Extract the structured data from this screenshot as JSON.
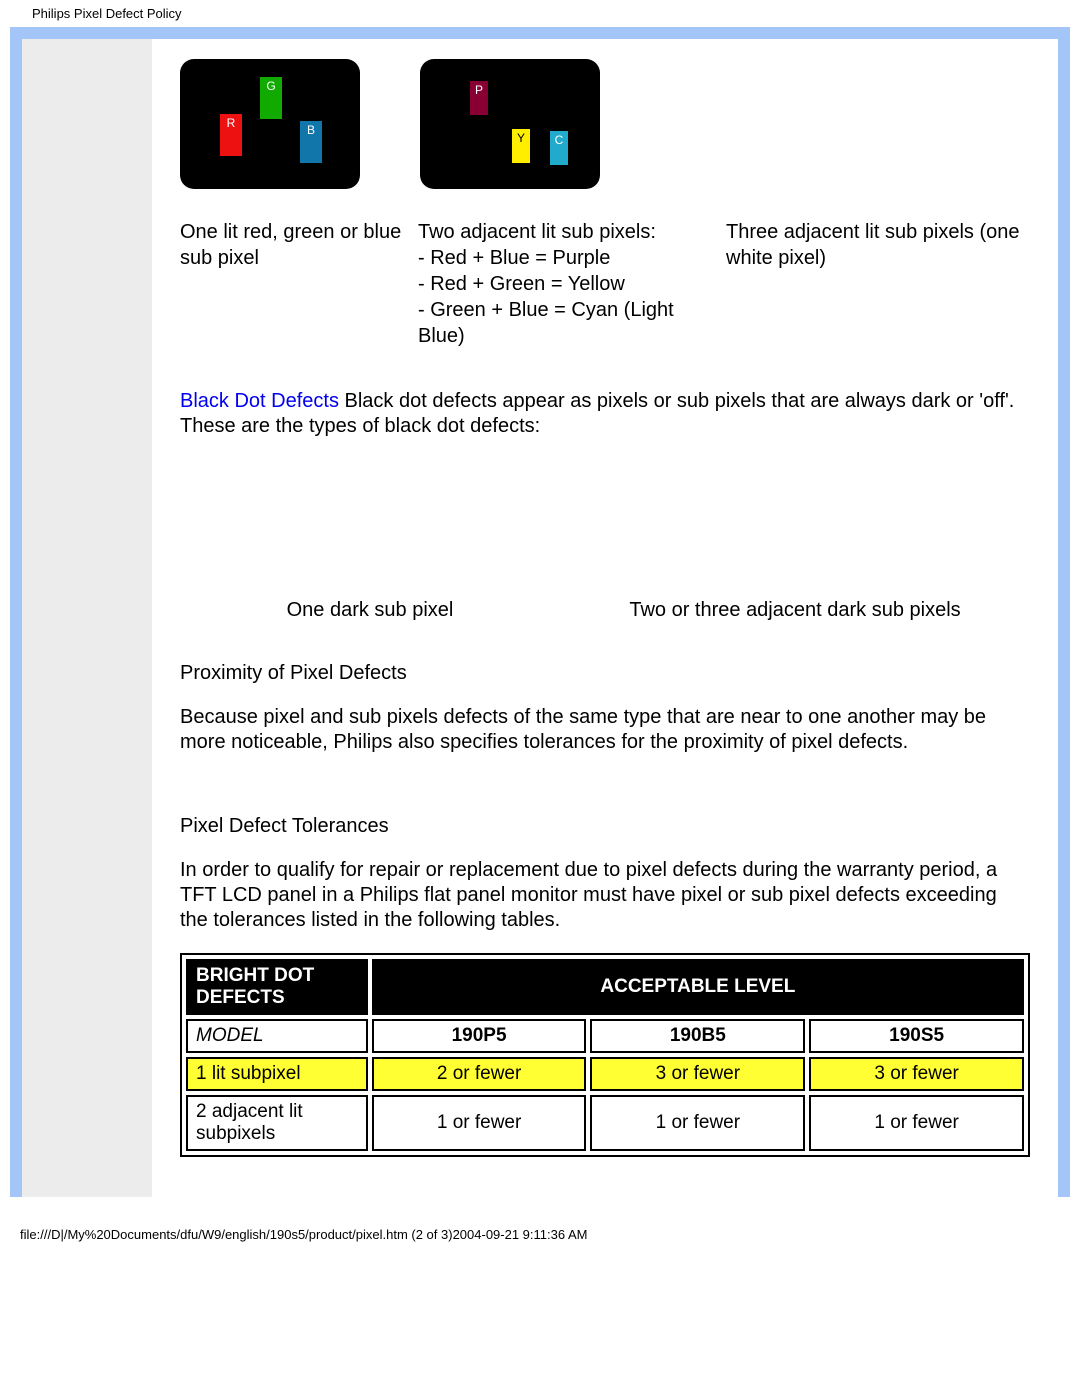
{
  "header": "Philips Pixel Defect Policy",
  "diagrams": {
    "d1": {
      "r": "R",
      "g": "G",
      "b": "B"
    },
    "d2": {
      "p": "P",
      "y": "Y",
      "c": "C"
    }
  },
  "captions": {
    "c1": "One lit red, green or blue sub pixel",
    "c2": "Two adjacent lit sub pixels:\n- Red + Blue = Purple\n- Red + Green = Yellow\n- Green + Blue = Cyan (Light Blue)",
    "c3": "Three adjacent lit sub pixels (one white pixel)"
  },
  "black_dot": {
    "link": "Black Dot Defects",
    "text": " Black dot defects appear as pixels or sub pixels that are always dark or 'off'. These are the types of black dot defects:"
  },
  "dark_captions": {
    "d1": "One dark sub pixel",
    "d2": "Two or three adjacent dark sub pixels"
  },
  "sections": {
    "proximity_title": "Proximity of Pixel Defects",
    "proximity_text": "Because pixel and sub pixels defects of the same type that are near to one another may be more noticeable, Philips also specifies tolerances for the proximity of pixel defects.",
    "tolerance_title": "Pixel Defect Tolerances",
    "tolerance_text": "In order to qualify for repair or replacement due to pixel defects during the warranty period, a TFT LCD panel in a Philips flat panel monitor must have pixel or sub pixel defects exceeding the tolerances listed in the following tables."
  },
  "table": {
    "head1": "BRIGHT DOT DEFECTS",
    "head2": "ACCEPTABLE LEVEL",
    "model_label": "MODEL",
    "models": [
      "190P5",
      "190B5",
      "190S5"
    ],
    "rows": [
      {
        "label": "1 lit subpixel",
        "vals": [
          "2 or fewer",
          "3 or fewer",
          "3 or fewer"
        ],
        "hl": true
      },
      {
        "label": "2 adjacent lit subpixels",
        "vals": [
          "1 or fewer",
          "1 or fewer",
          "1 or fewer"
        ],
        "hl": false
      }
    ]
  },
  "footer": "file:///D|/My%20Documents/dfu/W9/english/190s5/product/pixel.htm (2 of 3)2004-09-21 9:11:36 AM"
}
